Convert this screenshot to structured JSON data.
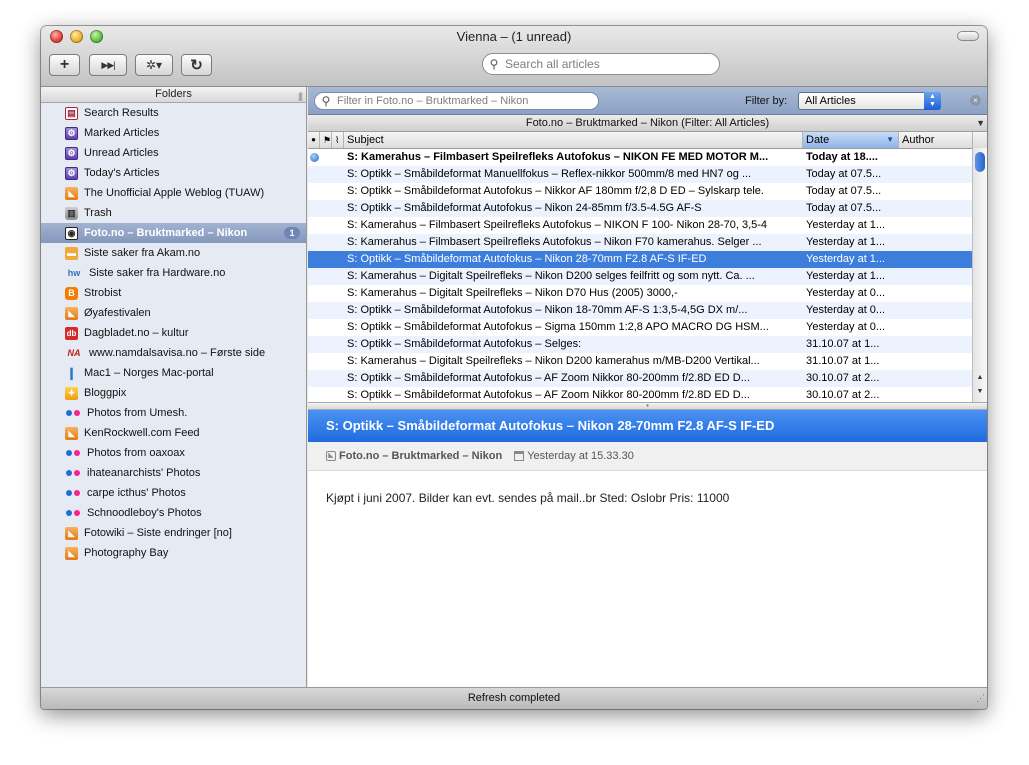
{
  "window": {
    "title": "Vienna – (1 unread)"
  },
  "toolbar": {
    "new_subscription_icon": "+",
    "skip_unread_icon": "▶▶|",
    "action_icon": "✲▾",
    "refresh_icon": "↻",
    "search_placeholder": "Search all articles"
  },
  "sidebar": {
    "header": "Folders",
    "items": [
      {
        "label": "Search Results",
        "icon": "search-results-icon",
        "glyph": "▤"
      },
      {
        "label": "Marked Articles",
        "icon": "smart-folder-icon",
        "glyph": "⚙"
      },
      {
        "label": "Unread Articles",
        "icon": "smart-folder-icon",
        "glyph": "⚙"
      },
      {
        "label": "Today's Articles",
        "icon": "smart-folder-icon",
        "glyph": "⚙"
      },
      {
        "label": "The Unofficial Apple Weblog (TUAW)",
        "icon": "rss-icon",
        "glyph": "◣"
      },
      {
        "label": "Trash",
        "icon": "trash-icon",
        "glyph": "▥"
      },
      {
        "label": "Foto.no – Bruktmarked – Nikon",
        "icon": "camera-icon",
        "glyph": "◉",
        "badge": "1"
      },
      {
        "label": "Siste saker fra Akam.no",
        "icon": "akam-icon",
        "glyph": "▬"
      },
      {
        "label": "Siste saker fra Hardware.no",
        "icon": "hardware-icon",
        "glyph": "hw"
      },
      {
        "label": "Strobist",
        "icon": "blogger-icon",
        "glyph": "B"
      },
      {
        "label": "Øyafestivalen",
        "icon": "rss-icon",
        "glyph": "◣"
      },
      {
        "label": "Dagbladet.no – kultur",
        "icon": "dagbladet-icon",
        "glyph": "db"
      },
      {
        "label": "www.namdalsavisa.no – Første side",
        "icon": "namdalsavisa-icon",
        "glyph": "NA"
      },
      {
        "label": "Mac1 – Norges Mac-portal",
        "icon": "mac1-icon",
        "glyph": "❙"
      },
      {
        "label": "Bloggpix",
        "icon": "bloggpix-icon",
        "glyph": "✦"
      },
      {
        "label": "Photos from Umesh.",
        "icon": "flickr-icon"
      },
      {
        "label": "KenRockwell.com Feed",
        "icon": "rss-icon",
        "glyph": "◣"
      },
      {
        "label": "Photos from oaxoax",
        "icon": "flickr-icon"
      },
      {
        "label": "ihateanarchists' Photos",
        "icon": "flickr-icon"
      },
      {
        "label": "carpe icthus' Photos",
        "icon": "flickr-icon"
      },
      {
        "label": "Schnoodleboy's Photos",
        "icon": "flickr-icon"
      },
      {
        "label": "Fotowiki – Siste endringer [no]",
        "icon": "rss-icon",
        "glyph": "◣"
      },
      {
        "label": "Photography Bay",
        "icon": "rss-icon",
        "glyph": "◣"
      }
    ]
  },
  "filter": {
    "placeholder": "Filter in Foto.no – Bruktmarked – Nikon",
    "filter_by_label": "Filter by:",
    "selected": "All Articles"
  },
  "scope_title": "Foto.no – Bruktmarked – Nikon (Filter: All Articles)",
  "columns": {
    "read": "●",
    "flag": "⚑",
    "attach": "⌇",
    "subject": "Subject",
    "date": "Date",
    "author": "Author"
  },
  "articles": [
    {
      "subject": "S: Kamerahus – Filmbasert Speilrefleks Autofokus – NIKON FE MED MOTOR M...",
      "date": "Today at 18....",
      "unread": true
    },
    {
      "subject": "S: Optikk – Småbildeformat Manuellfokus – Reflex-nikkor 500mm/8 med HN7 og ...",
      "date": "Today at 07.5..."
    },
    {
      "subject": "S: Optikk – Småbildeformat Autofokus – Nikkor AF 180mm f/2,8 D ED – Sylskarp tele.",
      "date": "Today at 07.5..."
    },
    {
      "subject": "S: Optikk – Småbildeformat Autofokus – Nikon 24-85mm f/3.5-4.5G AF-S",
      "date": "Today at 07.5..."
    },
    {
      "subject": "S: Kamerahus – Filmbasert Speilrefleks Autofokus – NIKON F 100- Nikon 28-70, 3,5-4",
      "date": "Yesterday at 1..."
    },
    {
      "subject": "S: Kamerahus – Filmbasert Speilrefleks Autofokus – Nikon F70 kamerahus. Selger ...",
      "date": "Yesterday at 1..."
    },
    {
      "subject": "S: Optikk – Småbildeformat Autofokus – Nikon 28-70mm F2.8 AF-S IF-ED",
      "date": "Yesterday at 1...",
      "selected": true
    },
    {
      "subject": "S: Kamerahus – Digitalt Speilrefleks – Nikon D200 selges feilfritt og som nytt. Ca. ...",
      "date": "Yesterday at 1..."
    },
    {
      "subject": "S: Kamerahus – Digitalt Speilrefleks – Nikon D70 Hus (2005) 3000,-",
      "date": "Yesterday at 0..."
    },
    {
      "subject": "S: Optikk – Småbildeformat Autofokus – Nikon 18-70mm AF-S 1:3,5-4,5G DX m/...",
      "date": "Yesterday at 0..."
    },
    {
      "subject": "S: Optikk – Småbildeformat Autofokus – Sigma 150mm 1:2,8 APO MACRO DG HSM...",
      "date": "Yesterday at 0..."
    },
    {
      "subject": "S: Optikk – Småbildeformat Autofokus – Selges:",
      "date": "31.10.07 at 1..."
    },
    {
      "subject": "S: Kamerahus – Digitalt Speilrefleks – Nikon D200 kamerahus m/MB-D200 Vertikal...",
      "date": "31.10.07 at 1..."
    },
    {
      "subject": "S: Optikk – Småbildeformat Autofokus – AF Zoom Nikkor 80-200mm f/2.8D ED D...",
      "date": "30.10.07 at 2..."
    },
    {
      "subject": "S: Optikk – Småbildeformat Autofokus – AF Zoom Nikkor 80-200mm f/2.8D ED D...",
      "date": "30.10.07 at 2..."
    }
  ],
  "preview": {
    "title": "S: Optikk – Småbildeformat Autofokus – Nikon 28-70mm F2.8 AF-S IF-ED",
    "feed": "Foto.no – Bruktmarked – Nikon",
    "date": "Yesterday at 15.33.30",
    "body": "Kjøpt i juni 2007. Bilder kan evt. sendes på mail..br Sted: Oslobr Pris: 11000"
  },
  "status": "Refresh completed",
  "colors": {
    "selection_row": "#3d7ddb",
    "preview_title": "#1f6ae0",
    "sidebar_bg": "#e6ebf3"
  }
}
